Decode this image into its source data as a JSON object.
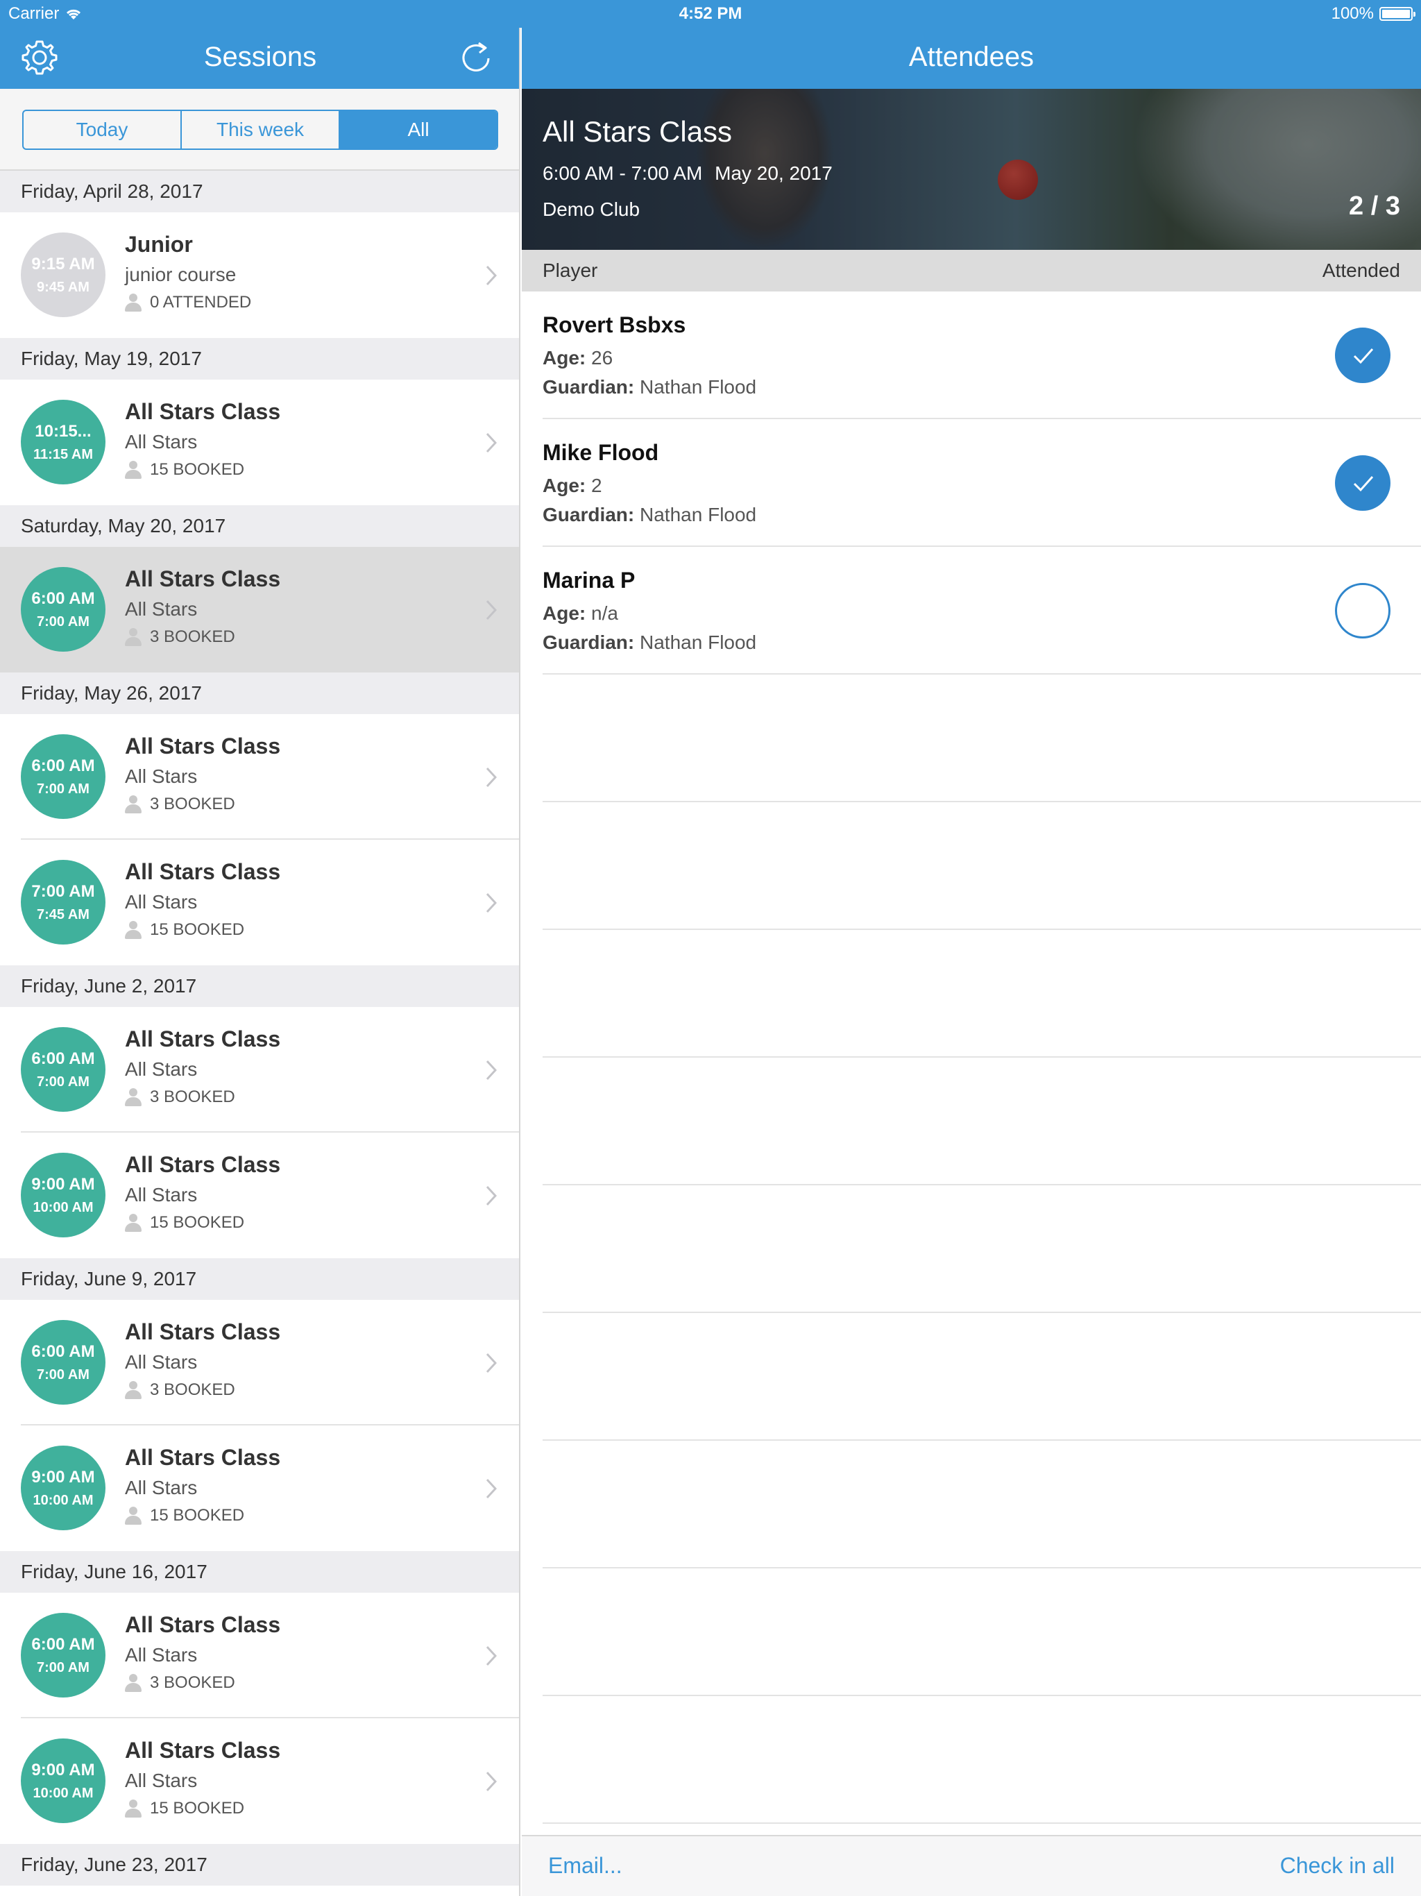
{
  "status_bar": {
    "carrier": "Carrier",
    "time": "4:52 PM",
    "battery": "100%"
  },
  "left": {
    "title": "Sessions",
    "segments": [
      "Today",
      "This week",
      "All"
    ],
    "active_segment": "All",
    "sections": [
      {
        "date": "Friday, April 28, 2017",
        "sessions": [
          {
            "start": "9:15 AM",
            "end": "9:45 AM",
            "name": "Junior",
            "sub": "junior course",
            "meta": "0 ATTENDED",
            "style": "grey"
          }
        ]
      },
      {
        "date": "Friday, May 19, 2017",
        "sessions": [
          {
            "start": "10:15...",
            "end": "11:15 AM",
            "name": "All Stars Class",
            "sub": "All Stars",
            "meta": "15 BOOKED"
          }
        ]
      },
      {
        "date": "Saturday, May 20, 2017",
        "sessions": [
          {
            "start": "6:00 AM",
            "end": "7:00 AM",
            "name": "All Stars Class",
            "sub": "All Stars",
            "meta": "3 BOOKED",
            "selected": true
          }
        ]
      },
      {
        "date": "Friday, May 26, 2017",
        "sessions": [
          {
            "start": "6:00 AM",
            "end": "7:00 AM",
            "name": "All Stars Class",
            "sub": "All Stars",
            "meta": "3 BOOKED"
          },
          {
            "start": "7:00 AM",
            "end": "7:45 AM",
            "name": "All Stars Class",
            "sub": "All Stars",
            "meta": "15 BOOKED"
          }
        ]
      },
      {
        "date": "Friday, June 2, 2017",
        "sessions": [
          {
            "start": "6:00 AM",
            "end": "7:00 AM",
            "name": "All Stars Class",
            "sub": "All Stars",
            "meta": "3 BOOKED"
          },
          {
            "start": "9:00 AM",
            "end": "10:00 AM",
            "name": "All Stars Class",
            "sub": "All Stars",
            "meta": "15 BOOKED"
          }
        ]
      },
      {
        "date": "Friday, June 9, 2017",
        "sessions": [
          {
            "start": "6:00 AM",
            "end": "7:00 AM",
            "name": "All Stars Class",
            "sub": "All Stars",
            "meta": "3 BOOKED"
          },
          {
            "start": "9:00 AM",
            "end": "10:00 AM",
            "name": "All Stars Class",
            "sub": "All Stars",
            "meta": "15 BOOKED"
          }
        ]
      },
      {
        "date": "Friday, June 16, 2017",
        "sessions": [
          {
            "start": "6:00 AM",
            "end": "7:00 AM",
            "name": "All Stars Class",
            "sub": "All Stars",
            "meta": "3 BOOKED"
          },
          {
            "start": "9:00 AM",
            "end": "10:00 AM",
            "name": "All Stars Class",
            "sub": "All Stars",
            "meta": "15 BOOKED"
          }
        ]
      },
      {
        "date": "Friday, June 23, 2017",
        "sessions": []
      }
    ]
  },
  "right": {
    "title": "Attendees",
    "hero": {
      "class_name": "All Stars Class",
      "time_range": "6:00 AM - 7:00 AM",
      "date": "May 20, 2017",
      "club": "Demo Club",
      "count": "2 / 3"
    },
    "table_header": {
      "player": "Player",
      "attended": "Attended"
    },
    "age_label": "Age:",
    "guardian_label": "Guardian:",
    "attendees": [
      {
        "name": "Rovert Bsbxs",
        "age": "26",
        "guardian": "Nathan Flood",
        "attended": true
      },
      {
        "name": "Mike Flood",
        "age": "2",
        "guardian": "Nathan Flood",
        "attended": true
      },
      {
        "name": "Marina P",
        "age": "n/a",
        "guardian": "Nathan Flood",
        "attended": false
      }
    ],
    "empty_rows": 9,
    "toolbar": {
      "email": "Email...",
      "check_in_all": "Check in all"
    }
  },
  "colors": {
    "accent": "#3a96d8",
    "teal": "#40b19c",
    "check_blue": "#2f86cc"
  }
}
